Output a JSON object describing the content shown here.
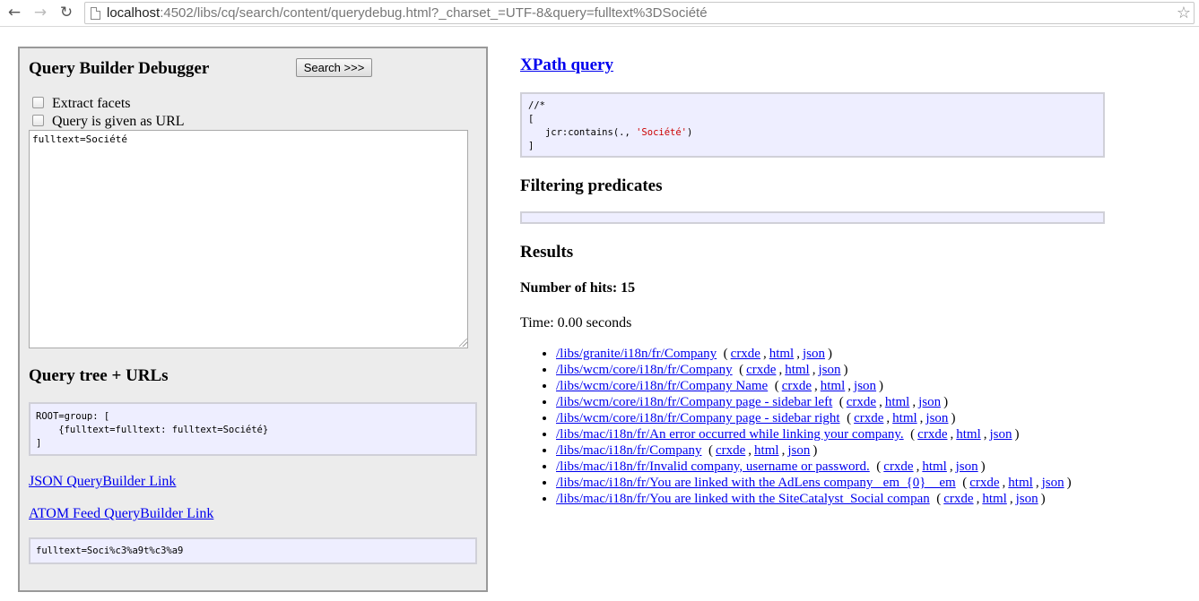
{
  "browser": {
    "back_icon": "←",
    "forward_icon": "→",
    "reload_icon": "↻",
    "url_host": "localhost",
    "url_rest": ":4502/libs/cq/search/content/querydebug.html?_charset_=UTF-8&query=fulltext%3DSociété",
    "star_icon": "☆"
  },
  "left": {
    "title": "Query Builder Debugger",
    "search_button": "Search >>>",
    "extract_facets_label": "Extract facets",
    "query_as_url_label": "Query is given as URL",
    "query_text": "fulltext=Société",
    "tree_title": "Query tree + URLs",
    "tree_text": "ROOT=group: [\n    {fulltext=fulltext: fulltext=Société}\n]",
    "json_link": "JSON QueryBuilder Link",
    "atom_link": "ATOM Feed QueryBuilder Link",
    "encoded_query": "fulltext=Soci%c3%a9t%c3%a9"
  },
  "right": {
    "xpath_title": "XPath query",
    "xpath_line1": "//*",
    "xpath_line2": "[",
    "xpath_line3_pre": "   jcr:contains(., ",
    "xpath_line3_str": "'Société'",
    "xpath_line3_post": ")",
    "xpath_line4": "]",
    "filtering_title": "Filtering predicates",
    "results_title": "Results",
    "hits_label": "Number of hits: 15",
    "time_label": "Time: 0.00 seconds",
    "link_crxde": "crxde",
    "link_html": "html",
    "link_json": "json",
    "results": [
      "/libs/granite/i18n/fr/Company",
      "/libs/wcm/core/i18n/fr/Company",
      "/libs/wcm/core/i18n/fr/Company Name",
      "/libs/wcm/core/i18n/fr/Company page - sidebar left",
      "/libs/wcm/core/i18n/fr/Company page - sidebar right",
      "/libs/mac/i18n/fr/An error occurred while linking your company.",
      "/libs/mac/i18n/fr/Company",
      "/libs/mac/i18n/fr/Invalid company, username or password.",
      "/libs/mac/i18n/fr/You are linked with the AdLens company _em_{0}__em",
      "/libs/mac/i18n/fr/You are linked with the SiteCatalyst_Social compan"
    ]
  }
}
